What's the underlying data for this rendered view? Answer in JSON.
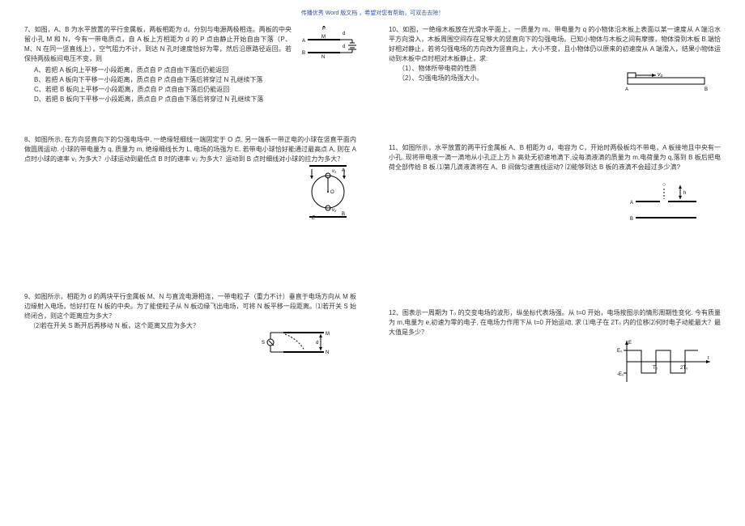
{
  "header": "传播优秀 Word 版文档 ，希望对您有帮助，可双击去除！",
  "left": {
    "p7": {
      "num": "7、",
      "body": "如图，A、B 为水平放置的平行金属板，两板相距为 d，分别与电源两极相连。两板的中央留小孔 M 和 N，今有一带电质点，自 A 板上方相距为 d 的 P 点由静止开始自由下落（P、M、N 在同一竖直线上），空气阻力不计，到达 N 孔时速度恰好为零，然后沿原路径返回。若保持两极板间电压不变，则",
      "A": "A、若把 A 板向上平移一小段距离，质点自 P 点自由下落后仍能返回",
      "B": "B、若把 A 板向下平移一小段距离，质点自 P 点自由下落后将穿过 N 孔继续下落",
      "C": "C、若把 B 板向上平移一小段距离，质点自 P 点自由下落后仍能返回",
      "D": "D、若把 B 板向下平移一小段距离，质点自 P 点自由下落后将穿过 N 孔继续下落"
    },
    "p8": {
      "num": "8、",
      "body": "如图所示, 在方向竖直向下的匀强电场中, 一绝缘轻细线一端固定于 O 点, 另一端系一带正电的小球在竖直平面内做圆周运动. 小球的带电量为 q, 质量为 m, 绝缘细线长为 L, 电场的场强为 E. 若带电小球恰好能通过最高点 A, 则在 A 点时小球的速率 v₁ 为多大？小球运动到最低点 B 时的速率 v₂ 为多大？运动到 B 点时细线对小球的拉力为多大？"
    },
    "p9": {
      "num": "9、",
      "body": "如图所示，相距为 d 的两块平行金属板 M、N 与直流电源相连，一带电粒子（重力不计）垂直于电场方向从 M 板边缘射入电场，恰好打在 N 板的中央。为了能使粒子从 N 板边缘飞出电场，可将 N 板平移一段距离。⑴若开关 S 始终闭合，则这个距离应为多大？",
      "sub2": "⑵若在开关 S 断开后再移动 N 板，这个距离又应为多大？"
    }
  },
  "right": {
    "p10": {
      "num": "10、",
      "body": "如图，一绝缘木板放在光滑水平面上，一质量为 m、带电量为 q 的小物体沿木板上表面以某一速度从 A 端沿水平方向滑入，木板周围空间存在足够大的竖直向下的匀强电场。已知小物体与木板之间有摩擦，物体滑到木板 B 端恰好相对静止，若将匀强电场的方向改为竖直向上，大小不变，且小物体仍以原来的初速度从 A 端滑入，结果小物体运动到木板中点时相对木板静止，求:",
      "q1": "  （1）、物体所带电荷的性质",
      "q2": "  （2）、匀强电场的场强大小。"
    },
    "p11": {
      "num": "11、",
      "body": "如图所示，水平放置的两平行金属板 A、B 相距为 d，电容为 C，开始时两极板均不带电，A 板接地且中央有一小孔. 现将带电液一滴一滴地从小孔正上方 h 高处无初速地滴下,设每滴液滴的质量为 m,电荷量为 q,落到 B 板后把电荷全部传给 B 板.⑴第几滴液滴将在 A、B 间做匀速直线运动? ⑵能够到达 B 板的液滴不会超过多少滴?"
    },
    "p12": {
      "num": "12、",
      "body": "图表示一周期为 T₀ 的交变电场的波形，纵坐标代表场强。从 t=0 开始，电场按图示的情形周期性变化. 今有质量为 m,电量为 e,初速为零的电子, 在电场力作用下从 t=0 开始运动, 求 ⑴电子在 2T₀ 内的位移⑵何时电子动能最大？最大值是多少？"
    }
  },
  "figs": {
    "p7": {
      "P": "P",
      "M": "M",
      "N": "N",
      "A": "A",
      "B": "B",
      "d": "d"
    },
    "p8": {
      "A": "A",
      "B": "B",
      "O": "O",
      "E": "E",
      "v1": "v₁",
      "v2": "v₂"
    },
    "p9": {
      "S": "S",
      "M": "M",
      "N": "N",
      "d": "d"
    },
    "p10": {
      "v0": "v₀",
      "A": "A",
      "B": "B"
    },
    "p11": {
      "O": "○",
      "A": "A",
      "B": "B",
      "h": "h"
    },
    "p12": {
      "E": "E",
      "E0": "E₀",
      "mE0": "-E₀",
      "T0": "T₀",
      "T2": "2T₀",
      "t": "t"
    }
  }
}
